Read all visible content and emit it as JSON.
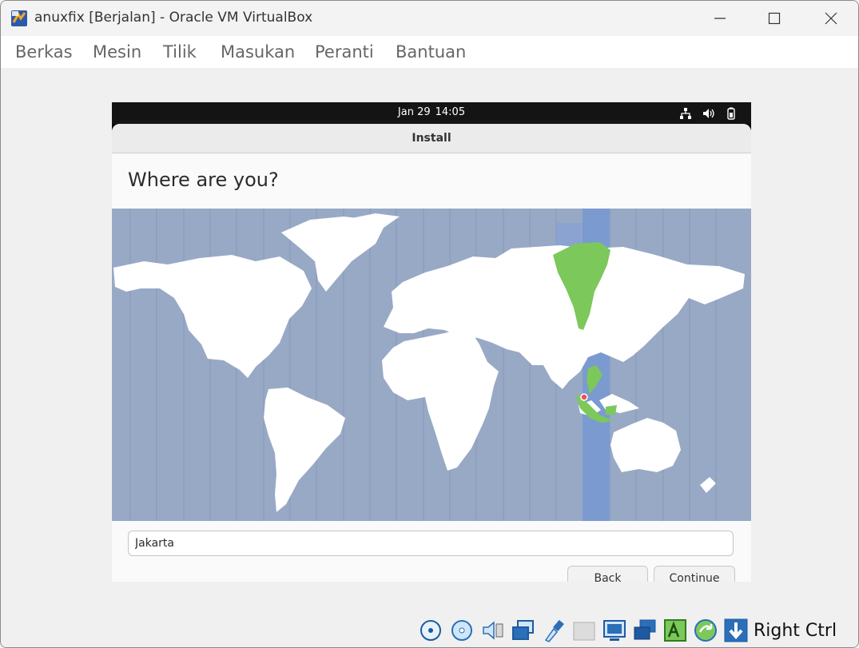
{
  "window": {
    "title": "anuxfix [Berjalan] - Oracle VM VirtualBox",
    "icons": [
      "virtualbox-app-icon",
      "minimize-icon",
      "maximize-icon",
      "close-icon"
    ]
  },
  "menubar": {
    "items": [
      "Berkas",
      "Mesin",
      "Tilik",
      "Masukan",
      "Peranti",
      "Bantuan"
    ]
  },
  "guest": {
    "topbar": {
      "date": "Jan 29",
      "time": "14:05",
      "tray_icons": [
        "network-icon",
        "volume-icon",
        "battery-icon"
      ]
    },
    "dialog": {
      "header_title": "Install",
      "page_title": "Where are you?",
      "location_value": "Jakarta",
      "back_label": "Back",
      "continue_label": "Continue"
    },
    "map_colors": {
      "ocean": "#98a9c6",
      "land": "#ffffff",
      "highlight_zone": "#7b9ad0",
      "selected_region": "#7cc85a",
      "pin": "#e8554e"
    }
  },
  "statusbar": {
    "host_key": "Right Ctrl",
    "icons": [
      "hard-disk-icon",
      "optical-disk-icon",
      "audio-icon",
      "network-adapter-icon",
      "usb-icon",
      "shared-folder-icon",
      "display-icon",
      "capture-icon",
      "recording-icon",
      "mouse-integration-icon",
      "keyboard-capture-icon"
    ]
  }
}
